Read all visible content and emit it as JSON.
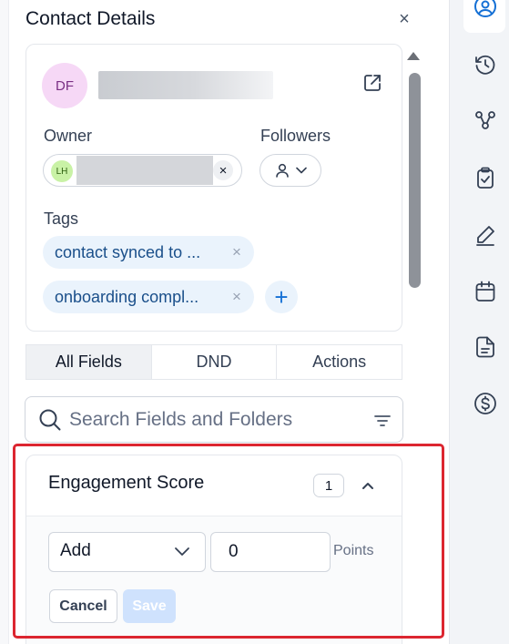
{
  "panel": {
    "title": "Contact Details",
    "close_label": "×"
  },
  "contact": {
    "initials": "DF",
    "avatar_bg": "#f6d8f6"
  },
  "owner": {
    "label": "Owner",
    "initials": "LH",
    "remove_label": "×"
  },
  "followers": {
    "label": "Followers"
  },
  "tags": {
    "label": "Tags",
    "items": [
      {
        "text": "contact synced to ...",
        "remove": "×"
      },
      {
        "text": "onboarding compl...",
        "remove": "×"
      }
    ],
    "add_label": "+"
  },
  "tabs": [
    {
      "label": "All Fields",
      "active": true
    },
    {
      "label": "DND",
      "active": false
    },
    {
      "label": "Actions",
      "active": false
    }
  ],
  "search": {
    "placeholder": "Search Fields and Folders"
  },
  "engagement": {
    "title": "Engagement Score",
    "count": "1",
    "operation": "Add",
    "points_value": "0",
    "points_label": "Points",
    "cancel_label": "Cancel",
    "save_label": "Save"
  },
  "colors": {
    "accent": "#1570d5",
    "highlight": "#dc2630",
    "tag_bg": "#eaf3fc",
    "save_disabled": "#cfe2fd"
  },
  "rail": {
    "icons": [
      "user-circle-icon",
      "clock-history-icon",
      "workflow-icon",
      "clipboard-check-icon",
      "pen-icon",
      "calendar-icon",
      "document-icon",
      "dollar-circle-icon"
    ]
  }
}
